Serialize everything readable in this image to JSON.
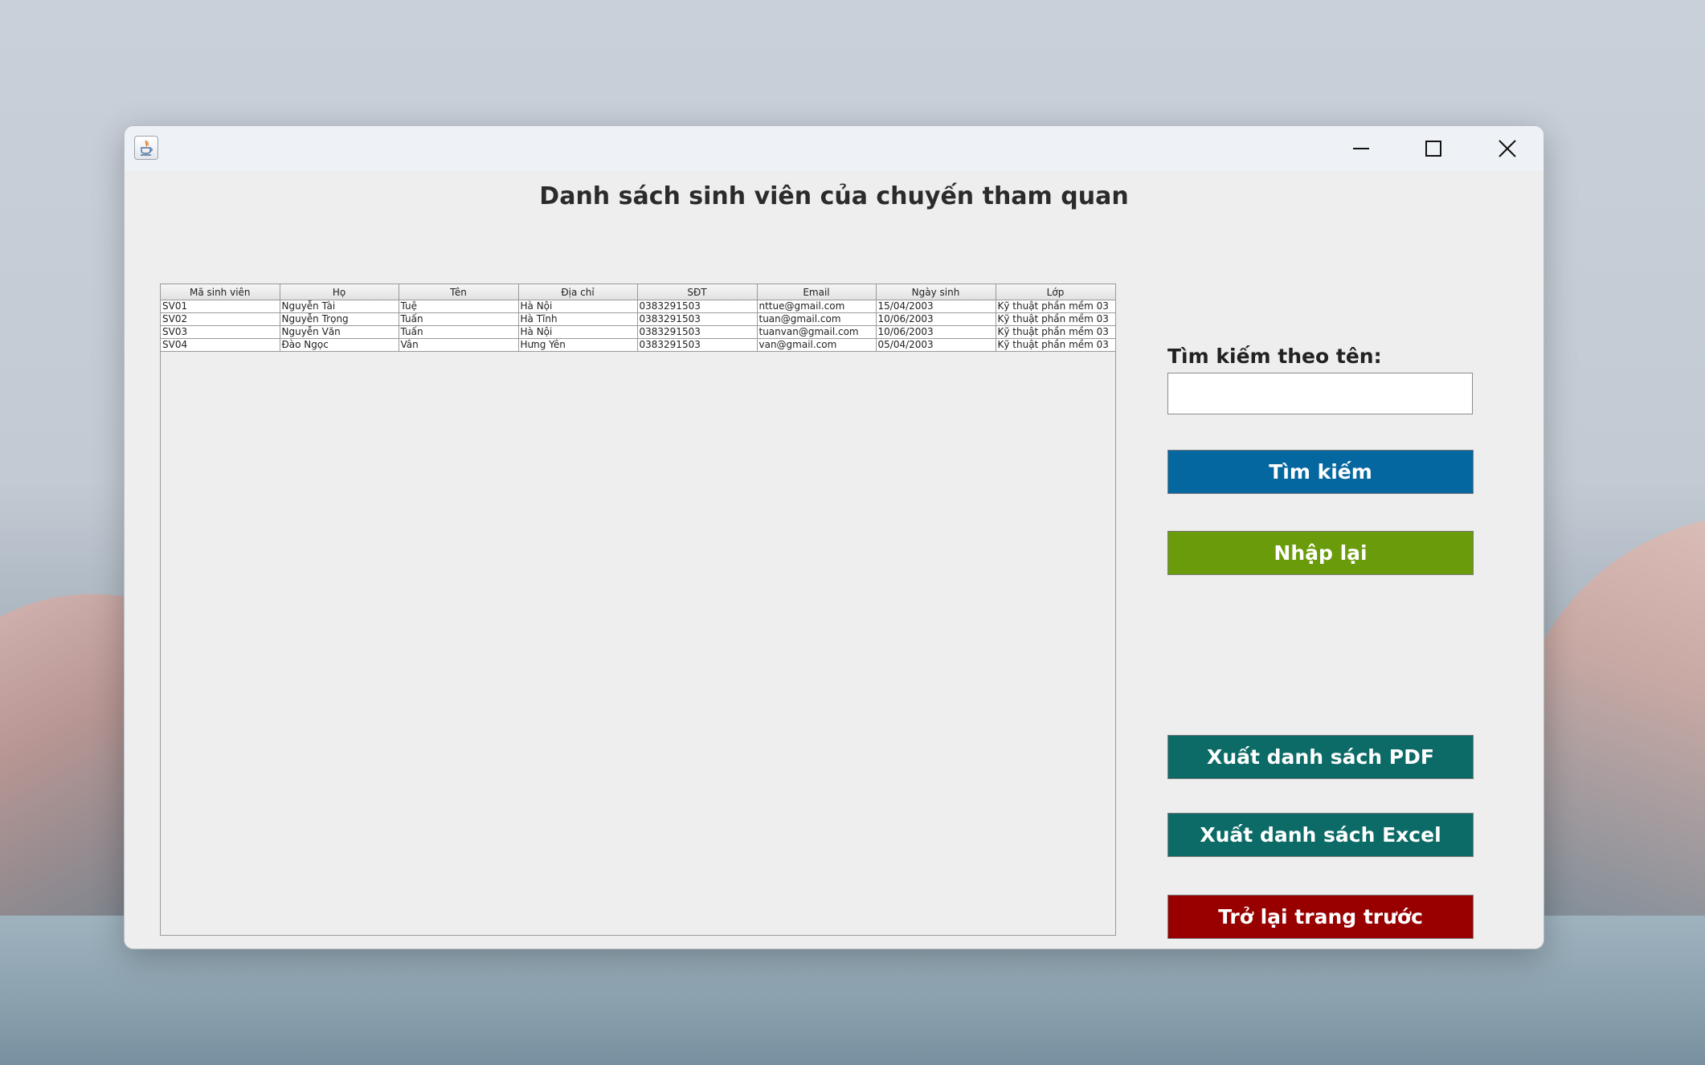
{
  "window": {
    "title_text": "",
    "controls": {
      "minimize": "minimize-icon",
      "maximize": "maximize-icon",
      "close": "close-icon"
    }
  },
  "page": {
    "title": "Danh sách sinh viên của chuyến tham quan"
  },
  "table": {
    "columns": [
      "Mã sinh viên",
      "Họ",
      "Tên",
      "Địa chỉ",
      "SĐT",
      "Email",
      "Ngày sinh",
      "Lớp"
    ],
    "rows": [
      [
        "SV01",
        "Nguyễn Tài",
        "Tuệ",
        "Hà Nội",
        "0383291503",
        "nttue@gmail.com",
        "15/04/2003",
        "Kỹ thuật phần mềm 03"
      ],
      [
        "SV02",
        "Nguyễn Trọng",
        "Tuấn",
        "Hà Tĩnh",
        "0383291503",
        "tuan@gmail.com",
        "10/06/2003",
        "Kỹ thuật phần mềm 03"
      ],
      [
        "SV03",
        "Nguyễn Văn",
        "Tuấn",
        "Hà Nội",
        "0383291503",
        "tuanvan@gmail.com",
        "10/06/2003",
        "Kỹ thuật phần mềm 03"
      ],
      [
        "SV04",
        "Đào Ngọc",
        "Vân",
        "Hưng Yên",
        "0383291503",
        "van@gmail.com",
        "05/04/2003",
        "Kỹ thuật phần mềm 03"
      ]
    ]
  },
  "search": {
    "label": "Tìm kiếm theo tên:",
    "value": "",
    "placeholder": ""
  },
  "buttons": {
    "search": "Tìm kiếm",
    "reset": "Nhập lại",
    "export_pdf": "Xuất danh sách PDF",
    "export_excel": "Xuất danh sách Excel",
    "back": "Trở lại trang trước"
  },
  "colors": {
    "search_btn": "#05679f",
    "reset_btn": "#6a9b0a",
    "export_btn": "#0c6b67",
    "back_btn": "#980000",
    "window_bg": "#eeeeee"
  }
}
